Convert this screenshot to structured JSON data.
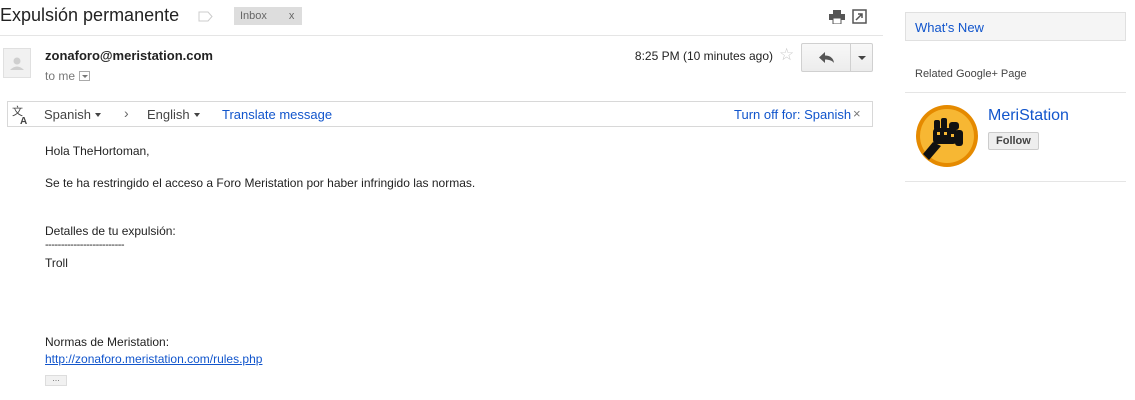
{
  "email": {
    "subject": "Expulsión permanente",
    "label": "Inbox",
    "label_remove": "x",
    "sender": "zonaforo@meristation.com",
    "recipient": "to me",
    "time": "8:25 PM (10 minutes ago)"
  },
  "translate_bar": {
    "from_language": "Spanish",
    "to_language": "English",
    "translate_action": "Translate message",
    "turn_off": "Turn off for: Spanish",
    "close": "×"
  },
  "body": {
    "greeting": "Hola TheHortoman,",
    "line1": "Se te ha restringido el acceso a Foro Meristation por haber infringido las normas.",
    "details_label": "Detalles de tu expulsión:",
    "separator": "-------------------------",
    "reason": "Troll",
    "rules_label": "Normas de Meristation:",
    "rules_link": "http://zonaforo.meristation.com/rules.php",
    "ellipsis": "..."
  },
  "sidebar": {
    "whats_new": "What's New",
    "related_title": "Related Google+ Page",
    "page_name": "MeriStation",
    "follow_label": "Follow"
  },
  "colors": {
    "link": "#1155cc",
    "label_bg": "#dddddd",
    "logo_orange": "#f39c12"
  },
  "icons": [
    "importance-marker-icon",
    "print-icon",
    "new-window-icon",
    "star-icon",
    "reply-icon",
    "translate-icon",
    "meristation-fist-icon"
  ]
}
